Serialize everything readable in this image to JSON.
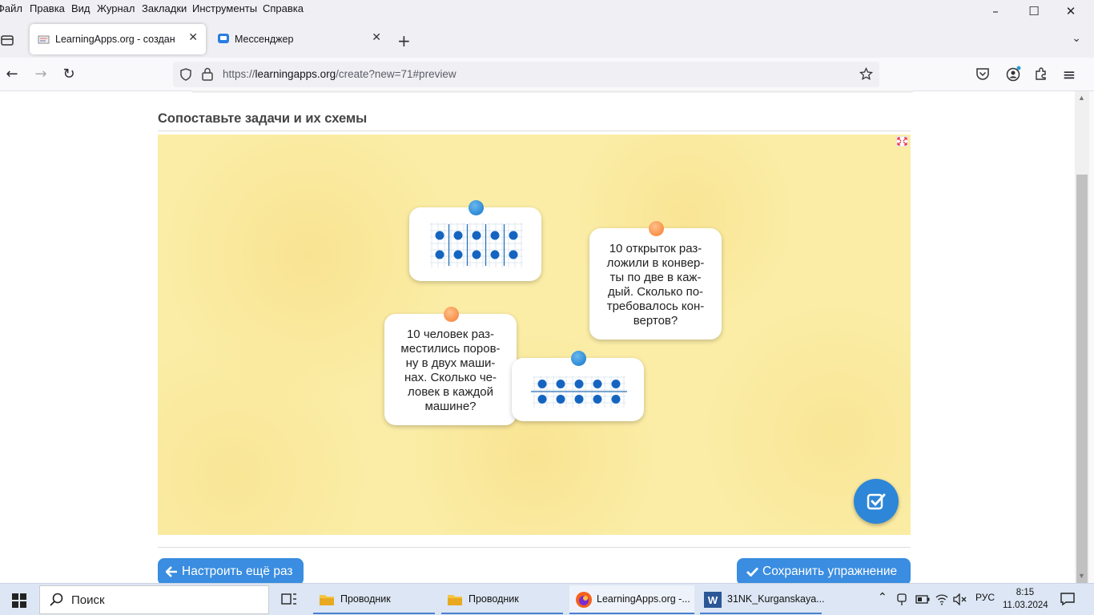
{
  "menu": [
    "Файл",
    "Правка",
    "Вид",
    "Журнал",
    "Закладки",
    "Инструменты",
    "Справка"
  ],
  "window_controls": {
    "minimize": "–",
    "maximize": "☐",
    "close": "✕"
  },
  "tabs": [
    {
      "title": "LearningApps.org - создание м",
      "active": true
    },
    {
      "title": "Мессенджер",
      "active": false
    }
  ],
  "tab_close": "✕",
  "new_tab": "+",
  "tabs_menu": "⌄",
  "nav": {
    "back": "←",
    "forward": "→",
    "reload": "↻",
    "menu": "≡"
  },
  "url": {
    "scheme": "https://",
    "host": "learningapps.org",
    "path": "/create?new=71#preview"
  },
  "page": {
    "title": "Сопоставьте задачи и их схемы",
    "cards": [
      {
        "type": "scheme",
        "pin_color": "#2d8ad5",
        "dots_per_row": 5,
        "rows": 2,
        "dividers": "vertical"
      },
      {
        "type": "text",
        "pin_color": "#f7904a",
        "lines": [
          "10 открыток раз-",
          "ложили в конвер-",
          "ты по две в каж-",
          "дый. Сколько по-",
          "требовалось кон-",
          "вертов?"
        ]
      },
      {
        "type": "text",
        "pin_color": "#f7904a",
        "lines": [
          "10 человек раз-",
          "местились поров-",
          "ну в двух маши-",
          "нах. Сколько че-",
          "ловек в каждой",
          "машине?"
        ]
      },
      {
        "type": "scheme",
        "pin_color": "#2d8ad5",
        "dots_per_row": 5,
        "rows": 2,
        "dividers": "horizontal"
      }
    ],
    "board_color": "#fbeda6",
    "accent_color": "#3a8de0",
    "buttons": {
      "reconfigure": "Настроить ещё раз",
      "save": "Сохранить упражнение"
    }
  },
  "taskbar": {
    "search": "Поиск",
    "items": [
      "Проводник",
      "Проводник",
      "LearningApps.org -...",
      "31NK_Kurganskaya..."
    ],
    "lang": "РУС",
    "time": "8:15",
    "date": "11.03.2024"
  }
}
